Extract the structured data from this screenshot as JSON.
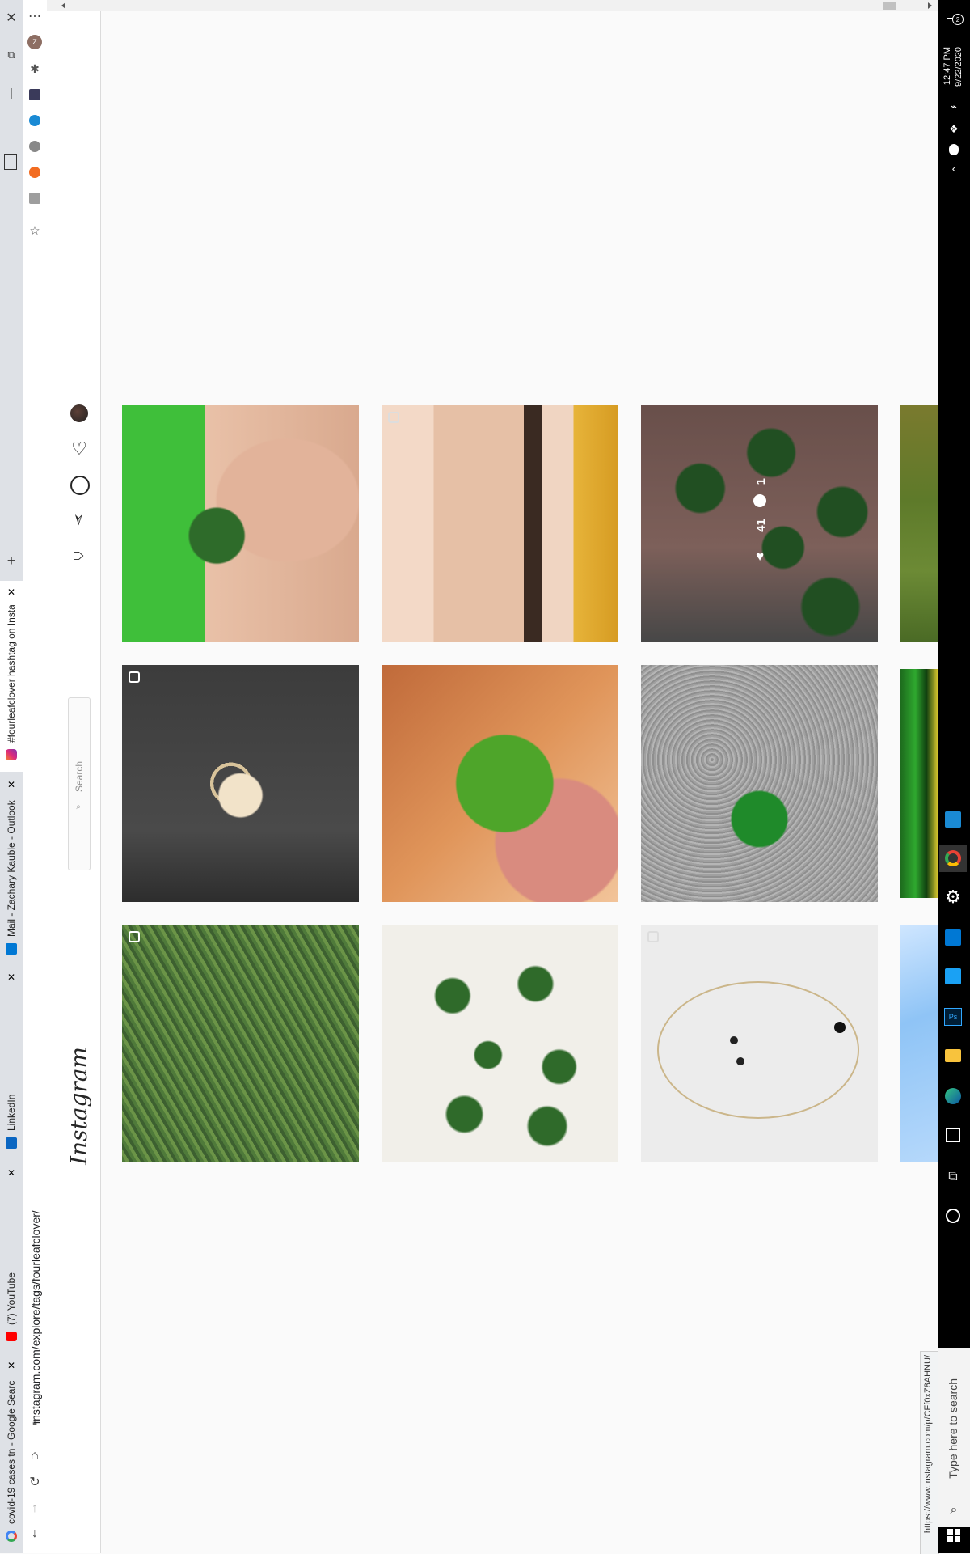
{
  "browser": {
    "tabs": [
      {
        "label": "covid-19 cases tn - Google Searc"
      },
      {
        "label": "(7) YouTube"
      },
      {
        "label": "LinkedIn"
      },
      {
        "label": "Mail - Zachary Kauble - Outlook"
      },
      {
        "label": "#fourleafclover hashtag on Insta"
      }
    ],
    "address": "instagram.com/explore/tags/fourleafclover/",
    "status_url": "https://www.instagram.com/p/CFf0xZ8AHNU/",
    "new_tab": "+"
  },
  "instagram": {
    "logo": "Instagram",
    "search_placeholder": "Search",
    "nav": [
      "home-icon",
      "direct-icon",
      "explore-icon",
      "activity-icon",
      "profile-avatar"
    ]
  },
  "hover_overlay": {
    "likes": "41",
    "comments": "1"
  },
  "taskbar": {
    "time": "12:47 PM",
    "date": "9/22/2020",
    "search_placeholder": "Type here to search",
    "notification_count": "2"
  },
  "colors": {
    "accent": "#3897f0",
    "taskbar": "#000000",
    "chrome": "#dee1e6"
  }
}
